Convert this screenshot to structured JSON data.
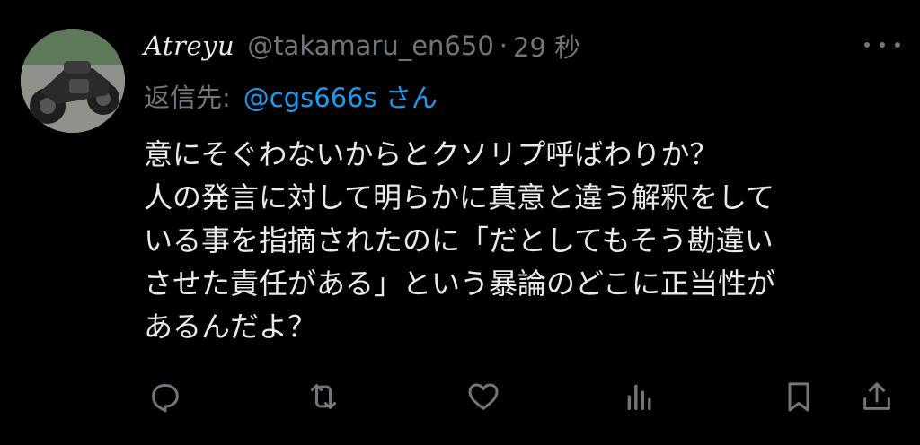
{
  "tweet": {
    "display_name": "Atreyu",
    "handle": "@takamaru_en650",
    "separator": "·",
    "time": "29 秒",
    "reply_label": "返信先:",
    "reply_user": "@cgs666s さん",
    "body_lines": [
      "意にそぐわないからとクソリプ呼ばわりか？",
      "人の発言に対して明らかに真意と違う解釈をして",
      "いる事を指摘されたのに「だとしてもそう勘違い",
      "させた責任がある」という暴論のどこに正当性が",
      "あるんだよ？"
    ]
  },
  "icons": {
    "more": "more-dots-icon",
    "reply": "reply-icon",
    "retweet": "retweet-icon",
    "like": "heart-icon",
    "views": "analytics-icon",
    "bookmark": "bookmark-icon",
    "share": "share-icon"
  },
  "colors": {
    "background": "#000000",
    "text": "#e7e9ea",
    "muted": "#71767b",
    "accent": "#1d9bf0"
  }
}
